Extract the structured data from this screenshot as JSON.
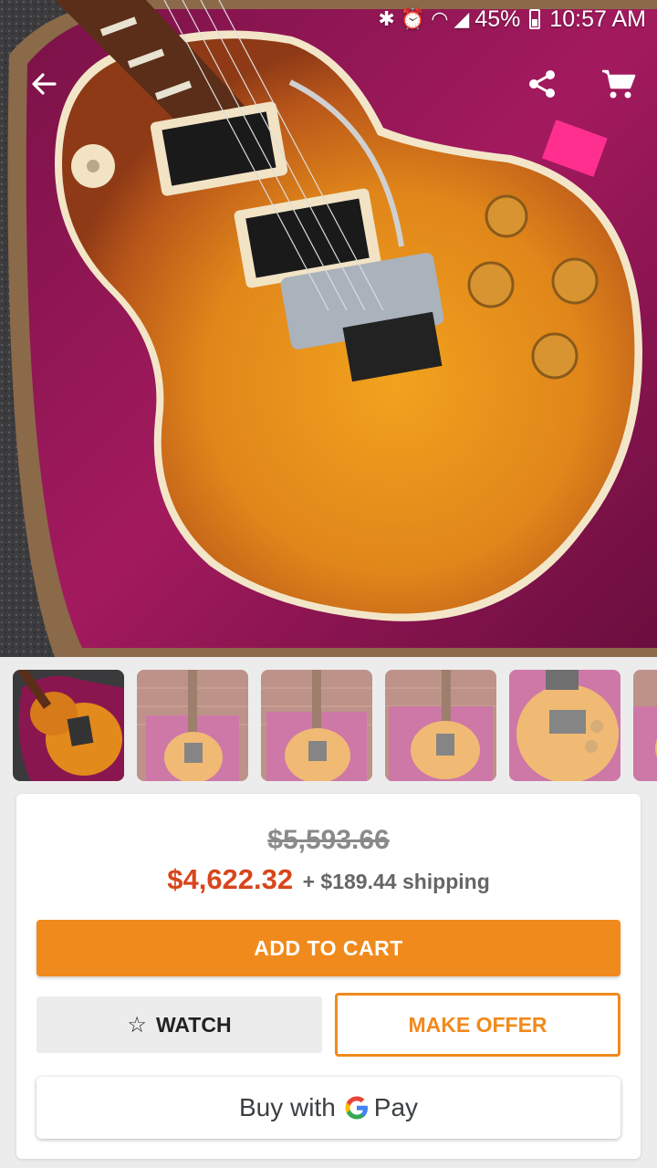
{
  "status_bar": {
    "icons": [
      "bluetooth-icon",
      "alarm-icon",
      "wifi-icon",
      "signal-icon",
      "battery-icon"
    ],
    "battery": "45%",
    "time": "10:57 AM"
  },
  "toolbar": {
    "back_icon": "arrow-left-icon",
    "share_icon": "share-icon",
    "cart_icon": "cart-icon"
  },
  "gallery": {
    "selected_index": 0,
    "thumbnails": [
      "photo-1",
      "photo-2",
      "photo-3",
      "photo-4",
      "photo-5",
      "photo-6"
    ]
  },
  "pricing": {
    "original_price": "$5,593.66",
    "price": "$4,622.32",
    "shipping": "+ $189.44 shipping"
  },
  "actions": {
    "add_to_cart": "ADD TO CART",
    "watch": "WATCH",
    "watch_icon": "star-outline-icon",
    "make_offer": "MAKE OFFER",
    "buy_with": "Buy with",
    "pay": "Pay"
  },
  "colors": {
    "accent": "#f18a1c",
    "price": "#d8461c"
  }
}
